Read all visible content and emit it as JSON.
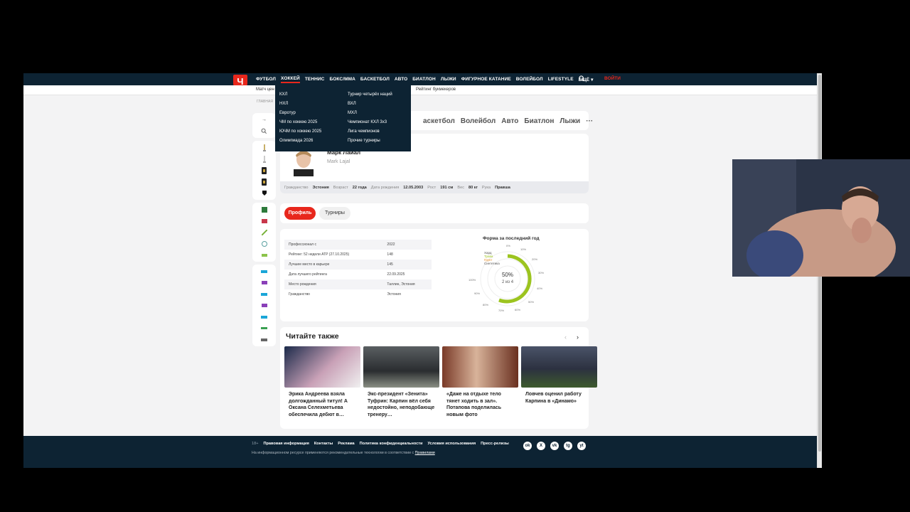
{
  "nav": {
    "logo": "Ч",
    "items": [
      "ФУТБОЛ",
      "ХОККЕЙ",
      "ТЕННИС",
      "БОКС/ММА",
      "БАСКЕТБОЛ",
      "АВТО",
      "БИАТЛОН",
      "ЛЫЖИ",
      "ФИГУРНОЕ КАТАНИЕ",
      "ВОЛЕЙБОЛ",
      "LIFESTYLE",
      "ЕЩЁ"
    ],
    "more_arrow": "▾",
    "login": "ВОЙТИ"
  },
  "subnav": {
    "left": "Матч цен",
    "right": "Рейтинг букмекеров"
  },
  "breadcrumb": "ГЛАВНАЯ",
  "dropdown": {
    "col1": [
      "КХЛ",
      "НХЛ",
      "Евротур",
      "ЧМ по хоккею 2025",
      "ЮЧМ по хоккею 2025",
      "Олимпиада 2026"
    ],
    "col2": [
      "Турнир четырёх наций",
      "ВХЛ",
      "МХЛ",
      "Чемпионат КХЛ 3х3",
      "Лига чемпионов",
      "Прочие турниры"
    ]
  },
  "sports_bar": {
    "labels": [
      "аскетбол",
      "Волейбол",
      "Авто",
      "Биатлон",
      "Лыжи"
    ],
    "more": "···"
  },
  "profile": {
    "name": "Марк Лайал",
    "name_latin": "Mark Lajal",
    "info": [
      {
        "label": "Гражданство",
        "value": "Эстония"
      },
      {
        "label": "Возраст",
        "value": "22 года"
      },
      {
        "label": "Дата рождения",
        "value": "12.05.2003"
      },
      {
        "label": "Рост",
        "value": "191 см"
      },
      {
        "label": "Вес",
        "value": "80 кг"
      },
      {
        "label": "Рука",
        "value": "Правша"
      }
    ]
  },
  "tabs": {
    "profile": "Профиль",
    "tournaments": "Турниры"
  },
  "stats": {
    "rows": [
      {
        "label": "Профессионал с",
        "value": "2022"
      },
      {
        "label": "Рейтинг: 52 недели ATP (27.10.2025)",
        "value": "148"
      },
      {
        "label": "Лучшее место в карьере",
        "value": "145"
      },
      {
        "label": "Дата лучшего рейтинга",
        "value": "22.09.2025"
      },
      {
        "label": "Место рождения",
        "value": "Таллин, Эстония"
      },
      {
        "label": "Гражданство",
        "value": "Эстония"
      }
    ],
    "form_title": "Форма за последний год",
    "surfaces": [
      "Хард",
      "Трава",
      "Грунт",
      "Синтетика"
    ],
    "percent": "50%",
    "wins": "2 из 4",
    "ticks": [
      "0%",
      "10%",
      "20%",
      "30%",
      "40%",
      "50%",
      "60%",
      "70%",
      "80%",
      "90%",
      "100%"
    ],
    "accent": "#9cc41f"
  },
  "read_also": {
    "title": "Читайте также",
    "prev": "‹",
    "next": "›",
    "items": [
      {
        "text": "Эрика Андреева взяла долгожданный титул! А Оксана Селехметьева обеспечила дебют в…"
      },
      {
        "text": "Экс-президент «Зенита» Туфрин: Карпин вёл себя недостойно, неподобающе тренеру…"
      },
      {
        "text": "«Даже на отдыхе тело тянет ходить в зал». Потапова поделилась новым фото"
      },
      {
        "text": "Ловчев оценил работу Карпина в «Динамо»"
      }
    ]
  },
  "footer": {
    "age": "18+",
    "links": [
      "Правовая информация",
      "Контакты",
      "Реклама",
      "Политика конфиденциальности",
      "Условия использования",
      "Пресс-релизы"
    ],
    "note": "На информационном ресурсе применяются рекомендательные технологии в соответствии с",
    "note_link": "Правилами",
    "socials": [
      "ok",
      "X",
      "vk",
      "tg",
      "yt"
    ]
  },
  "colors": {
    "brand": "#e8271c",
    "navbar": "#0d2333"
  }
}
